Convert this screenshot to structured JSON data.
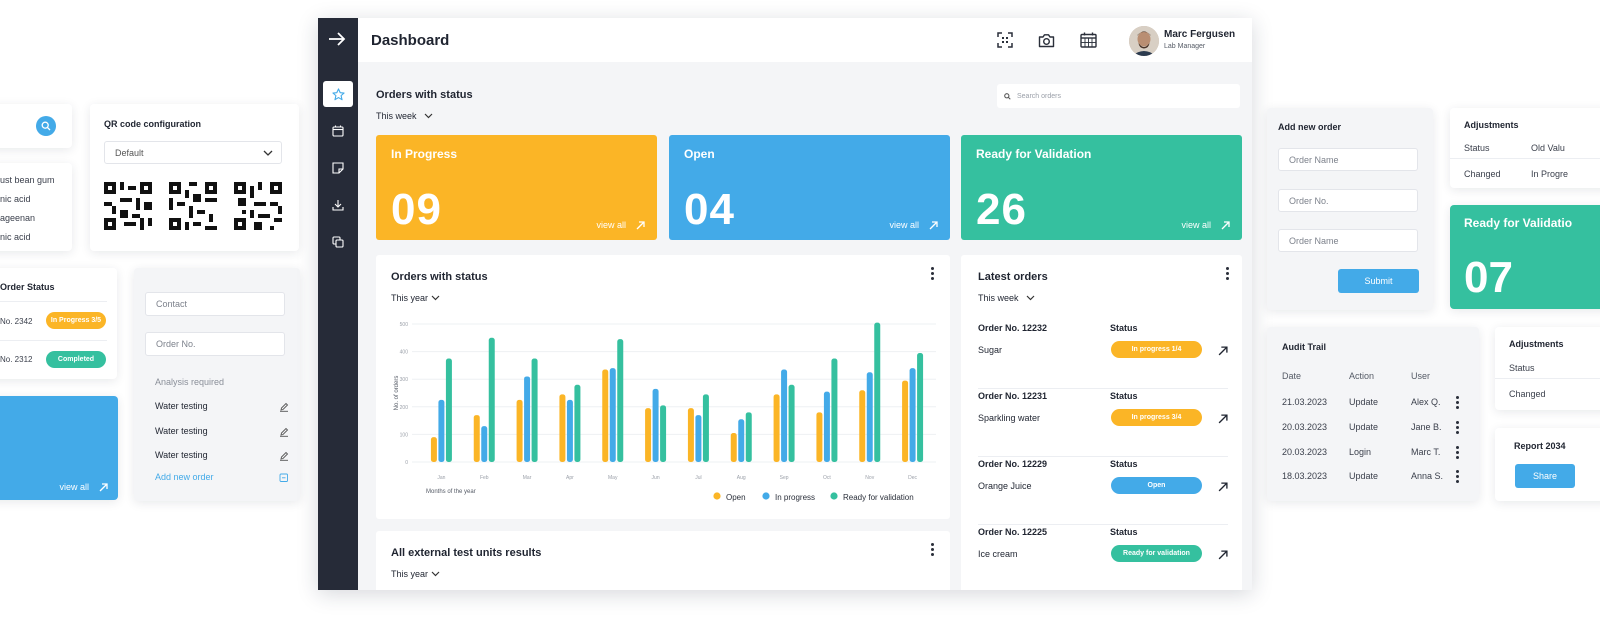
{
  "colors": {
    "yellow": "#fbb526",
    "blue": "#43aae8",
    "green": "#35c09f",
    "sidebar": "#262b38"
  },
  "left_search": {
    "icon": "search-icon"
  },
  "ingredients": {
    "items": [
      "ust bean gum",
      "nic acid",
      "ageenan",
      "nic acid"
    ]
  },
  "qr_card": {
    "title": "QR code configuration",
    "select_value": "Default"
  },
  "order_status_card": {
    "title": "Order Status",
    "rows": [
      {
        "order": "No. 2342",
        "status": "In Progress 3/5"
      },
      {
        "order": "No. 2312",
        "status": "Completed"
      }
    ]
  },
  "blue_tile": {
    "view_all": "view all"
  },
  "new_analysis_card": {
    "contact_placeholder": "Contact",
    "order_no_placeholder": "Order No.",
    "section_label": "Analysis required",
    "items": [
      "Water testing",
      "Water testing",
      "Water testing"
    ],
    "add_link": "Add new order"
  },
  "dashboard": {
    "title": "Dashboard",
    "user": {
      "name": "Marc Fergusen",
      "role": "Lab Manager"
    },
    "orders_section": {
      "title": "Orders with status",
      "period": "This week",
      "search_placeholder": "Search orders"
    },
    "stats": [
      {
        "label": "In Progress",
        "value": "09",
        "view_all": "view all"
      },
      {
        "label": "Open",
        "value": "04",
        "view_all": "view all"
      },
      {
        "label": "Ready for Validation",
        "value": "26",
        "view_all": "view all"
      }
    ],
    "chart_panel": {
      "title": "Orders with status",
      "period": "This year"
    },
    "latest_orders": {
      "title": "Latest orders",
      "period": "This week",
      "status_header": "Status",
      "rows": [
        {
          "order": "Order No. 12232",
          "product": "Sugar",
          "status": "In progress 1/4"
        },
        {
          "order": "Order No. 12231",
          "product": "Sparkling water",
          "status": "In progress 3/4"
        },
        {
          "order": "Order No. 12229",
          "product": "Orange Juice",
          "status": "Open"
        },
        {
          "order": "Order No. 12225",
          "product": "Ice cream",
          "status": "Ready for validation"
        }
      ]
    },
    "external_panel": {
      "title": "All external test units results",
      "period": "This year"
    }
  },
  "chart_data": {
    "type": "bar",
    "ylabel": "No. of orders",
    "xlabel": "Months of the year",
    "categories": [
      "Jan",
      "Feb",
      "Mar",
      "Apr",
      "May",
      "Jun",
      "Jul",
      "Aug",
      "Sep",
      "Oct",
      "Nov",
      "Dec"
    ],
    "yticks": [
      0,
      100,
      200,
      300,
      400,
      500
    ],
    "ylim": [
      0,
      500
    ],
    "series": [
      {
        "name": "Open",
        "color": "#fbb526",
        "values": [
          90,
          170,
          225,
          245,
          335,
          195,
          195,
          105,
          245,
          180,
          260,
          295
        ]
      },
      {
        "name": "In progress",
        "color": "#43aae8",
        "values": [
          225,
          130,
          310,
          225,
          340,
          265,
          170,
          155,
          335,
          255,
          325,
          340
        ]
      },
      {
        "name": "Ready for validation",
        "color": "#35c09f",
        "values": [
          375,
          450,
          375,
          280,
          445,
          205,
          245,
          180,
          280,
          375,
          505,
          395
        ]
      }
    ],
    "legend_position": "bottom-right"
  },
  "add_order_card": {
    "title": "Add new order",
    "fields": [
      "Order Name",
      "Order No.",
      "Order Name"
    ],
    "submit": "Submit"
  },
  "adjustments_top": {
    "title": "Adjustments",
    "headers": [
      "Status",
      "Old Valu"
    ],
    "row": [
      "Changed",
      "In Progre"
    ]
  },
  "green_tile": {
    "label": "Ready for Validatio",
    "value": "07"
  },
  "audit_trail": {
    "title": "Audit Trail",
    "headers": [
      "Date",
      "Action",
      "User"
    ],
    "rows": [
      [
        "21.03.2023",
        "Update",
        "Alex Q."
      ],
      [
        "20.03.2023",
        "Update",
        "Jane B."
      ],
      [
        "20.03.2023",
        "Login",
        "Marc T."
      ],
      [
        "18.03.2023",
        "Update",
        "Anna S."
      ]
    ]
  },
  "adjustments_bottom": {
    "title": "Adjustments",
    "header": "Status",
    "row": "Changed"
  },
  "report_card": {
    "title": "Report 2034",
    "button": "Share"
  }
}
